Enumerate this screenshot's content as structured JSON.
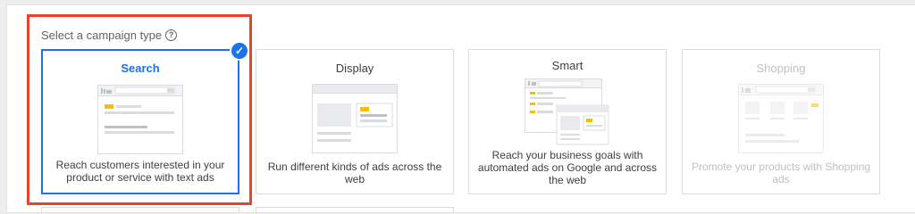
{
  "section": {
    "heading": "Select a campaign type",
    "help_icon": "question-circle-icon"
  },
  "campaign_types": [
    {
      "title": "Search",
      "description": "Reach customers interested in your product or service with text ads",
      "selected": true,
      "disabled": false
    },
    {
      "title": "Display",
      "description": "Run different kinds of ads across the web",
      "selected": false,
      "disabled": false
    },
    {
      "title": "Smart",
      "description": "Reach your business goals with automated ads on Google and across the web",
      "selected": false,
      "disabled": false
    },
    {
      "title": "Shopping",
      "description": "Promote your products with Shopping ads",
      "selected": false,
      "disabled": true
    }
  ],
  "colors": {
    "selected_accent": "#1a73e8",
    "highlight_outline": "#e8432d",
    "ad_badge": "#fbbc04",
    "disabled_text": "#bdc1c6"
  }
}
